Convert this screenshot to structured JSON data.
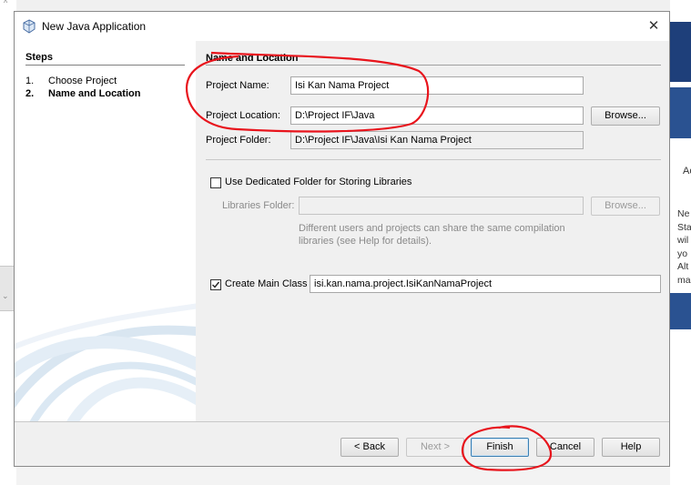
{
  "dialog": {
    "title": "New Java Application",
    "close_glyph": "✕",
    "icon": "java-cup-icon"
  },
  "steps": {
    "heading": "Steps",
    "items": [
      {
        "num": "1.",
        "label": "Choose Project"
      },
      {
        "num": "2.",
        "label": "Name and Location"
      }
    ]
  },
  "form": {
    "section_title": "Name and Location",
    "project_name_label": "Project Name:",
    "project_name_value": "Isi Kan Nama Project",
    "project_location_label": "Project Location:",
    "project_location_value": "D:\\Project IF\\Java",
    "project_folder_label": "Project Folder:",
    "project_folder_value": "D:\\Project IF\\Java\\Isi Kan Nama Project",
    "browse_label": "Browse...",
    "dedicated_folder_label": "Use Dedicated Folder for Storing Libraries",
    "dedicated_folder_checked": false,
    "libraries_folder_label": "Libraries Folder:",
    "libraries_folder_value": "",
    "libraries_browse_label": "Browse...",
    "help_text_line1": "Different users and projects can share the same compilation",
    "help_text_line2": "libraries (see Help for details).",
    "create_main_class_label": "Create Main Class",
    "create_main_class_checked": true,
    "main_class_value": "isi.kan.nama.project.IsiKanNamaProject"
  },
  "buttons": {
    "back": "< Back",
    "next": "Next >",
    "finish": "Finish",
    "cancel": "Cancel",
    "help": "Help"
  },
  "background": {
    "right_text_lines": [
      "Ne",
      "Sta",
      "wil",
      "yo",
      "Alt",
      "ma"
    ],
    "right_tab": "Ac"
  },
  "annotations": {
    "color": "#e8141c"
  }
}
